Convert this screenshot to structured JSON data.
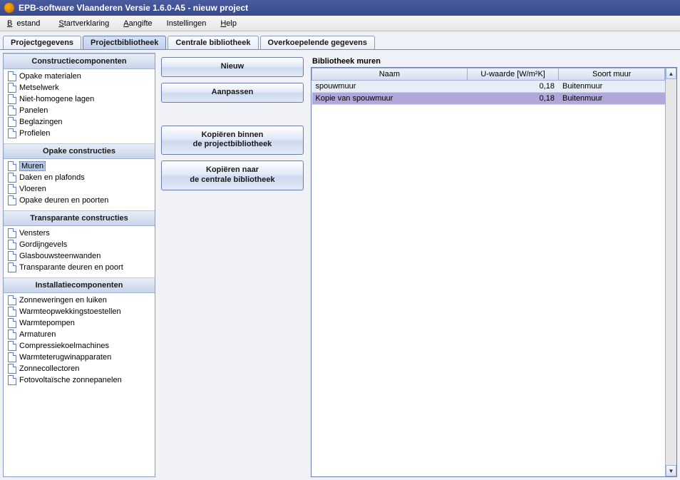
{
  "window": {
    "title": "EPB-software Vlaanderen Versie 1.6.0-A5 - nieuw project"
  },
  "menu": {
    "bestand": "Bestand",
    "startverklaring": "Startverklaring",
    "aangifte": "Aangifte",
    "instellingen": "Instellingen",
    "help": "Help"
  },
  "tabs": {
    "projectgegevens": "Projectgegevens",
    "projectbibliotheek": "Projectbibliotheek",
    "centrale": "Centrale bibliotheek",
    "overkoepelende": "Overkoepelende gegevens"
  },
  "sidebar": {
    "groups": [
      {
        "title": "Constructiecomponenten",
        "items": [
          "Opake materialen",
          "Metselwerk",
          "Niet-homogene lagen",
          "Panelen",
          "Beglazingen",
          "Profielen"
        ]
      },
      {
        "title": "Opake constructies",
        "items": [
          "Muren",
          "Daken en plafonds",
          "Vloeren",
          "Opake deuren en poorten"
        ],
        "selected": 0
      },
      {
        "title": "Transparante constructies",
        "items": [
          "Vensters",
          "Gordijngevels",
          "Glasbouwsteenwanden",
          "Transparante deuren en poort"
        ]
      },
      {
        "title": "Installatiecomponenten",
        "items": [
          "Zonneweringen en luiken",
          "Warmteopwekkingstoestellen",
          "Warmtepompen",
          "Armaturen",
          "Compressiekoelmachines",
          "Warmteterugwinapparaten",
          "Zonnecollectoren",
          "Fotovoltaïsche zonnepanelen"
        ]
      }
    ]
  },
  "buttons": {
    "nieuw": "Nieuw",
    "aanpassen": "Aanpassen",
    "kopieren_binnen_l1": "Kopiëren binnen",
    "kopieren_binnen_l2": "de projectbibliotheek",
    "kopieren_naar_l1": "Kopiëren naar",
    "kopieren_naar_l2": "de centrale bibliotheek"
  },
  "library": {
    "title": "Bibliotheek muren",
    "columns": {
      "naam": "Naam",
      "uwaarde": "U-waarde [W/m²K]",
      "soort": "Soort muur"
    },
    "rows": [
      {
        "naam": "spouwmuur",
        "uwaarde": "0,18",
        "soort": "Buitenmuur",
        "selected": false
      },
      {
        "naam": "Kopie van spouwmuur",
        "uwaarde": "0,18",
        "soort": "Buitenmuur",
        "selected": true
      }
    ]
  }
}
